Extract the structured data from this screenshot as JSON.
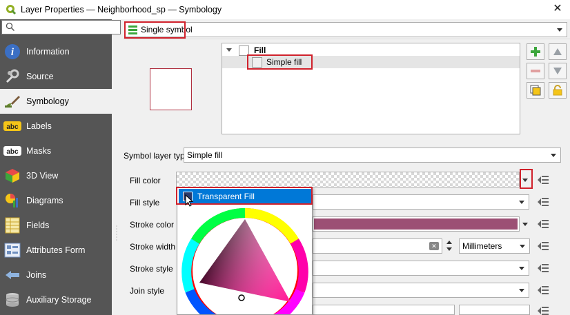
{
  "window": {
    "title": "Layer Properties — Neighborhood_sp — Symbology",
    "close": "✕"
  },
  "search": {
    "placeholder": ""
  },
  "sidebar": {
    "items": [
      {
        "label": "Information",
        "icon": "info-icon"
      },
      {
        "label": "Source",
        "icon": "wrench-icon"
      },
      {
        "label": "Symbology",
        "icon": "paintbrush-icon"
      },
      {
        "label": "Labels",
        "icon": "abc-labels-icon"
      },
      {
        "label": "Masks",
        "icon": "abc-mask-icon"
      },
      {
        "label": "3D View",
        "icon": "cube-icon"
      },
      {
        "label": "Diagrams",
        "icon": "bar-chart-icon"
      },
      {
        "label": "Fields",
        "icon": "table-icon"
      },
      {
        "label": "Attributes Form",
        "icon": "form-icon"
      },
      {
        "label": "Joins",
        "icon": "join-icon"
      },
      {
        "label": "Auxiliary Storage",
        "icon": "database-icon"
      }
    ],
    "active_index": 2
  },
  "renderer": {
    "value": "Single symbol"
  },
  "symbol_tree": {
    "root": "Fill",
    "child": "Simple fill"
  },
  "symbol_layer_type": {
    "label": "Symbol layer type",
    "value": "Simple fill"
  },
  "fields": {
    "fill_color": {
      "label": "Fill color"
    },
    "fill_style": {
      "label": "Fill style"
    },
    "stroke_color": {
      "label": "Stroke color",
      "color": "#9c4f74"
    },
    "stroke_width": {
      "label": "Stroke width",
      "unit": "Millimeters"
    },
    "stroke_style": {
      "label": "Stroke style"
    },
    "join_style": {
      "label": "Join style"
    }
  },
  "color_popup": {
    "item": "Transparent Fill"
  },
  "colors": {
    "accent": "#0078d7",
    "highlight": "#d0212b",
    "sidebar": "#555555",
    "preview_border": "#b03040"
  }
}
